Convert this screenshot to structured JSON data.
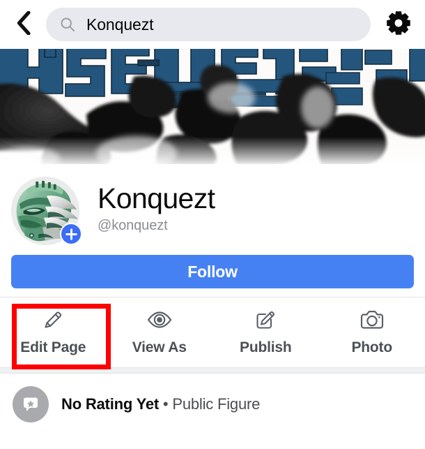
{
  "topbar": {
    "back_icon": "chevron-left-icon",
    "search": {
      "icon": "search-icon",
      "value": "Konquezt",
      "placeholder": "Search"
    },
    "settings_icon": "gear-icon"
  },
  "cover": {
    "alt": "cover-photo-graffiti",
    "text_color": "#24567d",
    "background": "#fbfbf9"
  },
  "profile": {
    "avatar_alt": "konquezt-profile-picture",
    "avatar_badge_icon": "plus-icon",
    "badge_color": "#3b6ef5",
    "name": "Konquezt",
    "handle": "@konquezt"
  },
  "follow": {
    "label": "Follow",
    "color": "#4681f4"
  },
  "actions": [
    {
      "id": "edit-page",
      "label": "Edit Page",
      "icon": "pencil-icon",
      "highlighted": true
    },
    {
      "id": "view-as",
      "label": "View As",
      "icon": "eye-icon",
      "highlighted": false
    },
    {
      "id": "publish",
      "label": "Publish",
      "icon": "compose-icon",
      "highlighted": false
    },
    {
      "id": "photo",
      "label": "Photo",
      "icon": "camera-icon",
      "highlighted": false
    }
  ],
  "highlight": {
    "color": "#fe0000",
    "target": "Edit Page"
  },
  "rating": {
    "icon": "star-bubble-icon",
    "status": "No Rating Yet",
    "separator": "•",
    "category": "Public Figure"
  }
}
